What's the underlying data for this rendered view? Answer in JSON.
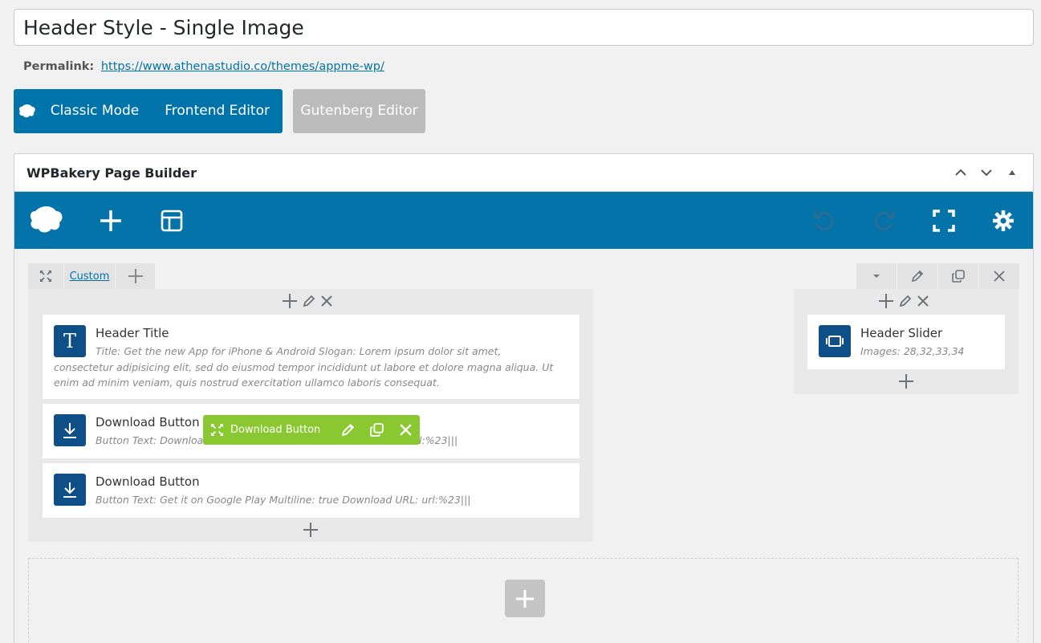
{
  "post": {
    "title": "Header Style - Single Image",
    "permalink_label": "Permalink:",
    "permalink_url": "https://www.athenastudio.co/themes/appme-wp/"
  },
  "editor_modes": {
    "classic": "Classic Mode",
    "frontend": "Frontend Editor",
    "gutenberg": "Gutenberg Editor"
  },
  "panel": {
    "title": "WPBakery Page Builder"
  },
  "row": {
    "layout_label": "Custom"
  },
  "left_column": {
    "elements": [
      {
        "icon": "T",
        "title": "Header Title",
        "description": "Title: Get the new App for iPhone & Android  Slogan: Lorem ipsum dolor sit amet, consectetur adipisicing elit, sed do eiusmod tempor incididunt ut labore et dolore magna aliqua. Ut enim ad minim veniam, quis nostrud exercitation ullamco laboris consequat."
      },
      {
        "icon": "download-icon",
        "title": "Download Button",
        "description_start": "Button Text: Downloa",
        "description_end": "url:%23|||"
      },
      {
        "icon": "download-icon",
        "title": "Download Button",
        "description": "Button Text: Get it on Google Play  Multiline: true  Download URL: url:%23|||"
      }
    ],
    "hover_toolbar_label": "Download Button"
  },
  "right_column": {
    "elements": [
      {
        "icon": "slider-icon",
        "title": "Header Slider",
        "description": "Images: 28,32,33,34"
      }
    ]
  },
  "colors": {
    "brand_blue": "#0073aa",
    "element_icon": "#0d4f86",
    "hover_green": "#8ac832",
    "disabled_gray": "#bbbbbb"
  }
}
